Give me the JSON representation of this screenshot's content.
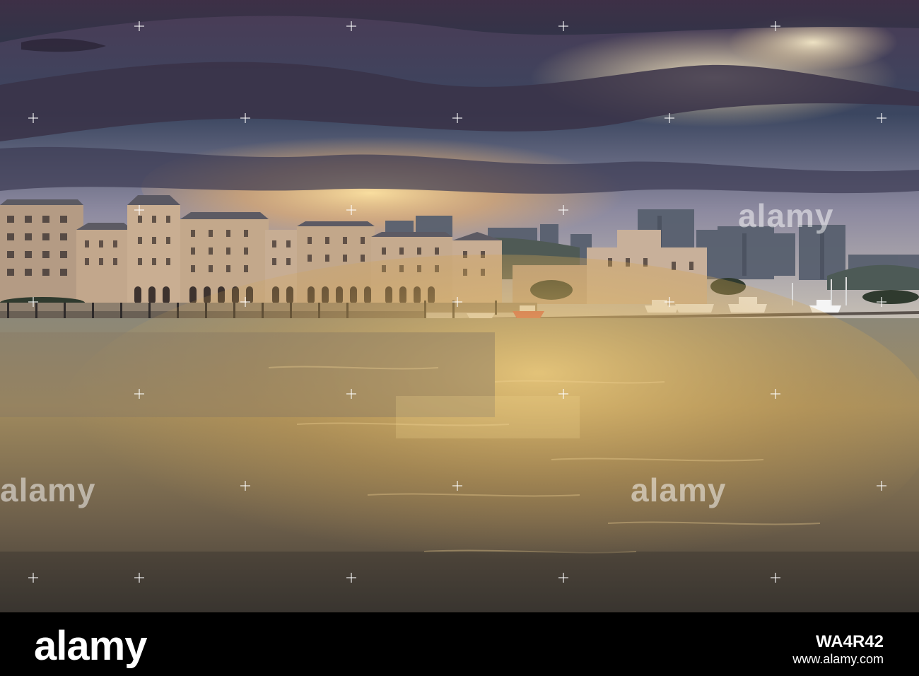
{
  "watermarks": {
    "top": "alamy",
    "middle_left": "alamy",
    "middle_right": "alamy"
  },
  "footer": {
    "logo": "alamy",
    "image_id": "WA4R42",
    "domain": "www.alamy.com"
  },
  "colors": {
    "sky_top": "#3a3550",
    "sunset_glow": "#f3c26b",
    "water_gold": "#d6a84c",
    "water_shadow": "#4a4038",
    "building_tan": "#c6ab8e",
    "bar_bg": "#000000"
  }
}
